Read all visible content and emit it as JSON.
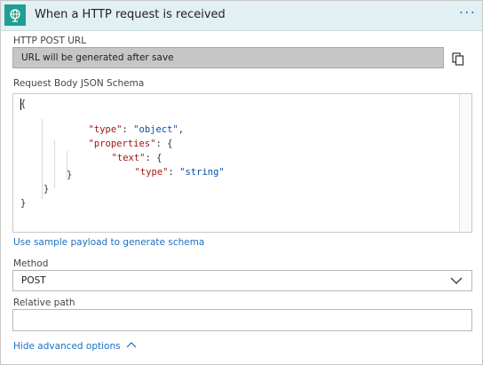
{
  "header": {
    "title": "When a HTTP request is received",
    "trigger_icon": "globe-request-icon",
    "more_label": "···",
    "background_color": "#e2f0f3",
    "icon_color": "#1f9e93"
  },
  "http_post_url": {
    "label": "HTTP POST URL",
    "value": "URL will be generated after save",
    "copy_icon": "copy-icon"
  },
  "schema": {
    "label": "Request Body JSON Schema",
    "lines": [
      "{",
      "\"type\": \"object\",",
      "\"properties\": {",
      "\"text\": {",
      "\"type\": \"string\"",
      "}",
      "}",
      "}"
    ]
  },
  "sample_payload_link": "Use sample payload to generate schema",
  "method": {
    "label": "Method",
    "value": "POST"
  },
  "relative_path": {
    "label": "Relative path",
    "value": ""
  },
  "advanced_link": "Hide advanced options",
  "colors": {
    "link": "#1b6fc4",
    "json_key": "#a31515",
    "json_string": "#0451a5"
  }
}
